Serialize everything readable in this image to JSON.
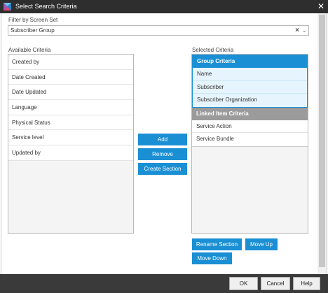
{
  "window": {
    "title": "Select Search Criteria"
  },
  "filter": {
    "label": "Filter by Screen Set",
    "value": "Subscriber Group"
  },
  "available": {
    "label": "Available Criteria",
    "items": [
      "Created by",
      "Date Created",
      "Date Updated",
      "Language",
      "Physical Status",
      "Service level",
      "Updated by"
    ]
  },
  "middle_buttons": {
    "add": "Add",
    "remove": "Remove",
    "create_section": "Create Section"
  },
  "selected": {
    "label": "Selected Criteria",
    "groups": [
      {
        "title": "Group Criteria",
        "items": [
          "Name",
          "Subscriber",
          "Subscriber Organization"
        ]
      },
      {
        "title": "Linked Item Criteria",
        "items": [
          "Service Action",
          "Service Bundle"
        ]
      }
    ]
  },
  "section_buttons": {
    "rename": "Rename Section",
    "move_up": "Move Up",
    "move_down": "Move Down"
  },
  "footer": {
    "ok": "OK",
    "cancel": "Cancel",
    "help": "Help"
  },
  "colors": {
    "accent": "#1a8fd4",
    "header_dark": "#2e2e2e",
    "group_gray": "#9b9b9b"
  }
}
